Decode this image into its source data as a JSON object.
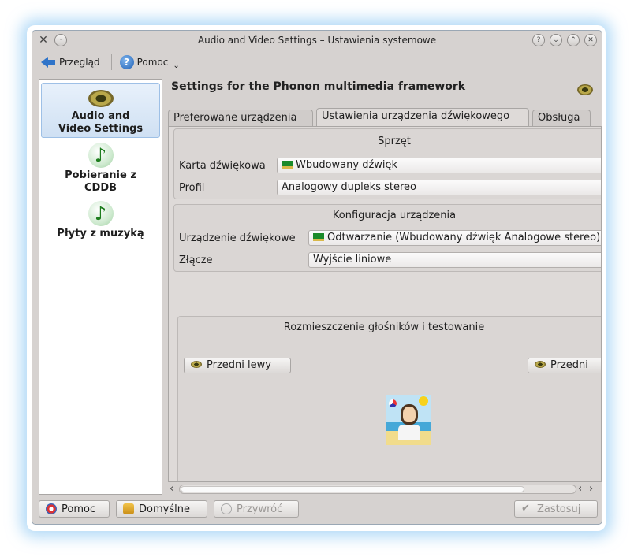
{
  "window": {
    "title": "Audio and Video Settings – Ustawienia systemowe"
  },
  "title_buttons": [
    "?",
    "⌄",
    "⌃",
    "✕"
  ],
  "toolbar": {
    "back_label": "Przegląd",
    "help_label": "Pomoc"
  },
  "sidebar": {
    "items": [
      {
        "label_line1": "Audio and",
        "label_line2": "Video Settings",
        "icon": "speaker-icon",
        "active": true
      },
      {
        "label_line1": "Pobieranie z",
        "label_line2": "CDDB",
        "icon": "music-note-icon"
      },
      {
        "label_line1": "Płyty z muzyką",
        "label_line2": "",
        "icon": "music-note-icon"
      }
    ]
  },
  "header": {
    "title": "Settings for the Phonon multimedia framework"
  },
  "tabs": [
    {
      "label": "Preferowane urządzenia"
    },
    {
      "label": "Ustawienia urządzenia dźwiękowego",
      "active": true
    },
    {
      "label": "Obsługa"
    }
  ],
  "hardware": {
    "title": "Sprzęt",
    "card_label": "Karta dźwiękowa",
    "card_value": "Wbudowany dźwięk",
    "profile_label": "Profil",
    "profile_value": "Analogowy dupleks stereo"
  },
  "device_config": {
    "title": "Konfiguracja urządzenia",
    "device_label": "Urządzenie dźwiękowe",
    "device_value": "Odtwarzanie (Wbudowany dźwięk Analogowe stereo)",
    "connector_label": "Złącze",
    "connector_value": "Wyjście liniowe"
  },
  "speakers": {
    "title": "Rozmieszczenie głośników i testowanie",
    "front_left": "Przedni lewy",
    "front_right": "Przedni"
  },
  "bottom_buttons": {
    "help": "Pomoc",
    "defaults": "Domyślne",
    "reset": "Przywróć",
    "apply": "Zastosuj"
  }
}
